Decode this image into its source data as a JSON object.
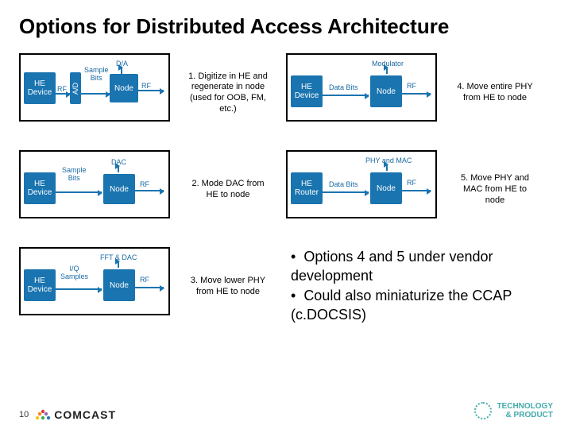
{
  "title": "Options for Distributed Access Architecture",
  "page_number": "10",
  "footer": {
    "brand": "COMCAST",
    "right_logo_top": "TECHNOLOGY",
    "right_logo_bottom": "& PRODUCT"
  },
  "labels": {
    "he_device": "HE\nDevice",
    "he_router": "HE\nRouter",
    "node": "Node",
    "modulator": "Modulator",
    "phy_mac": "PHY and MAC",
    "fft_dac": "FFT & DAC",
    "dac": "DAC",
    "da": "D/A",
    "ad": "A/D",
    "rf": "RF",
    "sample_bits": "Sample\nBits",
    "iq_samples": "I/Q\nSamples",
    "data_bits": "Data Bits"
  },
  "captions": {
    "c1": "1. Digitize in HE and regenerate in node (used for OOB, FM, etc.)",
    "c2": "2. Mode DAC from HE to node",
    "c3": "3. Move lower PHY from HE to node",
    "c4": "4. Move entire PHY from HE to node",
    "c5": "5. Move PHY and MAC from HE to node"
  },
  "bullets": {
    "b1": "Options 4 and 5 under vendor development",
    "b2": "Could also miniaturize the CCAP (c.DOCSIS)"
  }
}
